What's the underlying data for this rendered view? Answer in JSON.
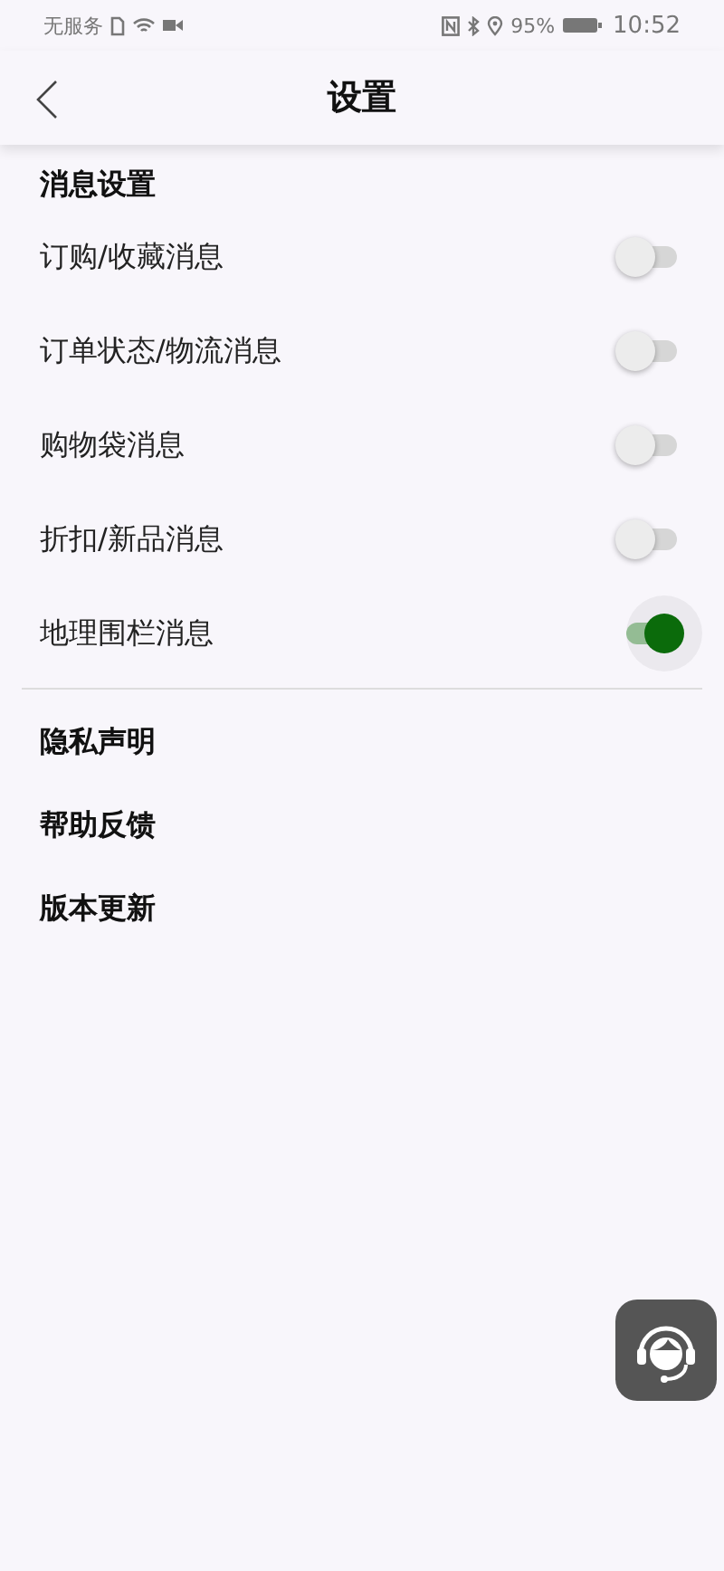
{
  "status_bar": {
    "carrier": "无服务",
    "battery": "95%",
    "time": "10:52"
  },
  "header": {
    "title": "设置"
  },
  "section": {
    "title": "消息设置",
    "items": [
      {
        "label": "订购/收藏消息",
        "on": false
      },
      {
        "label": "订单状态/物流消息",
        "on": false
      },
      {
        "label": "购物袋消息",
        "on": false
      },
      {
        "label": "折扣/新品消息",
        "on": false
      },
      {
        "label": "地理围栏消息",
        "on": true
      }
    ]
  },
  "links": [
    "隐私声明",
    "帮助反馈",
    "版本更新"
  ]
}
